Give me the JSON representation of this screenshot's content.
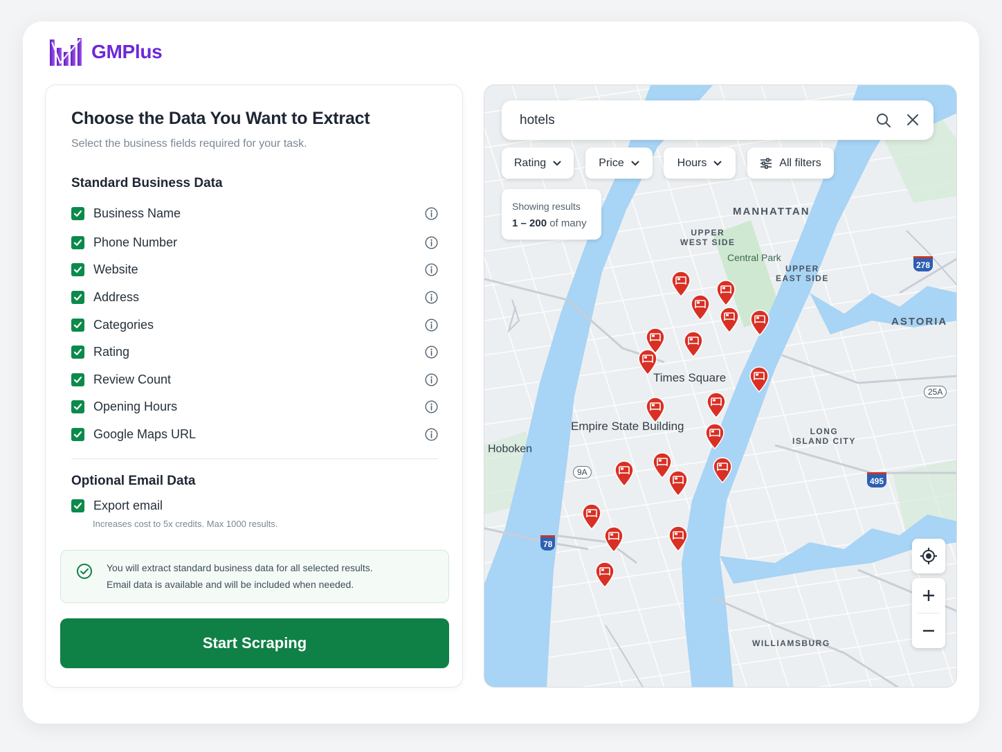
{
  "brand": {
    "name": "GMPlus",
    "logo_icon": "bar-chart-logo",
    "accent": "#6d28d9"
  },
  "panel": {
    "title": "Choose the Data You Want to Extract",
    "subtitle": "Select the business fields required for your task.",
    "standard_title": "Standard Business Data",
    "fields": [
      {
        "label": "Business Name",
        "checked": true
      },
      {
        "label": "Phone Number",
        "checked": true
      },
      {
        "label": "Website",
        "checked": true
      },
      {
        "label": "Address",
        "checked": true
      },
      {
        "label": "Categories",
        "checked": true
      },
      {
        "label": "Rating",
        "checked": true
      },
      {
        "label": "Review Count",
        "checked": true
      },
      {
        "label": "Opening Hours",
        "checked": true
      },
      {
        "label": "Google Maps URL",
        "checked": true
      }
    ],
    "optional_title": "Optional Email Data",
    "email": {
      "label": "Export email",
      "checked": true,
      "hint": "Increases cost to 5x credits. Max 1000 results."
    },
    "notice": {
      "line1": "You will extract standard business data for all selected results.",
      "line2": "Email data is available and will be included when needed."
    },
    "start_label": "Start Scraping",
    "check_color": "#0c8a4b"
  },
  "map": {
    "search_value": "hotels",
    "filters": [
      {
        "label": "Rating",
        "icon": "chevron-down-icon"
      },
      {
        "label": "Price",
        "icon": "chevron-down-icon"
      },
      {
        "label": "Hours",
        "icon": "chevron-down-icon"
      },
      {
        "label": "All filters",
        "icon": "sliders-icon"
      }
    ],
    "results_line1": "Showing results",
    "results_range": "1 – 200",
    "results_suffix": "of many",
    "labels": {
      "manhattan": "MANHATTAN",
      "upper_west": "UPPER\nWEST SIDE",
      "upper_east": "UPPER\nEAST SIDE",
      "central_park": "Central Park",
      "astoria": "ASTORIA",
      "times_square": "Times Square",
      "empire_state": "Empire State Building",
      "hoboken": "Hoboken",
      "long_island": "LONG\nISLAND CITY",
      "williamsburg": "WILLIAMSBURG"
    },
    "shields": {
      "i278": "278",
      "r25a": "25A",
      "r9a": "9A",
      "i495": "495",
      "i78": "78"
    },
    "pin_color": "#d93025"
  }
}
